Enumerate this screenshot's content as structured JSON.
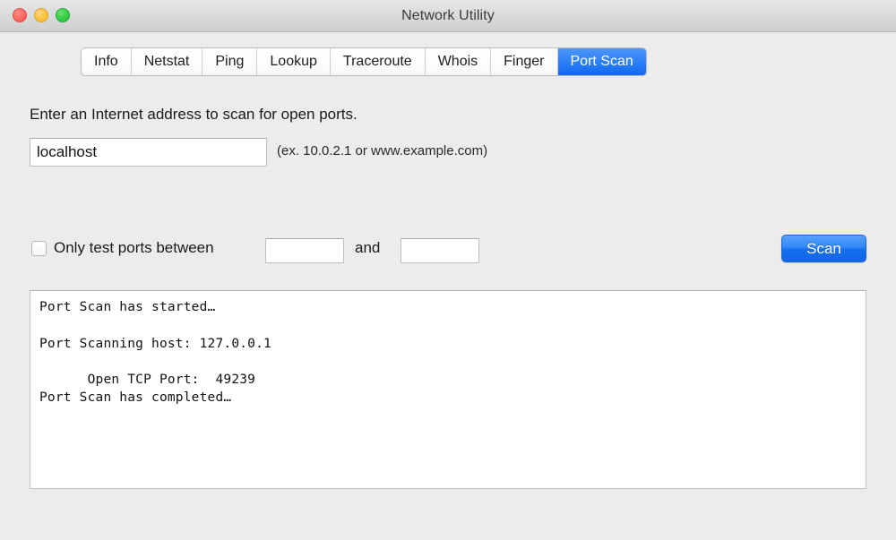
{
  "window": {
    "title": "Network Utility",
    "traffic_lights": [
      {
        "name": "close",
        "color": "#ff5f57"
      },
      {
        "name": "minimize",
        "color": "#ffbd2e"
      },
      {
        "name": "maximize",
        "color": "#28c840"
      }
    ],
    "background_color": "#ececec"
  },
  "tabs": {
    "active": "Port Scan",
    "active_color": "#2d80f7",
    "items": [
      {
        "label": "Info",
        "active": false
      },
      {
        "label": "Netstat",
        "active": false
      },
      {
        "label": "Ping",
        "active": false
      },
      {
        "label": "Lookup",
        "active": false
      },
      {
        "label": "Traceroute",
        "active": false
      },
      {
        "label": "Whois",
        "active": false
      },
      {
        "label": "Finger",
        "active": false
      },
      {
        "label": "Port Scan",
        "active": true
      }
    ]
  },
  "port_scan": {
    "prompt": "Enter an Internet address to scan for open ports.",
    "address": {
      "value": "localhost",
      "placeholder": "",
      "hint": "(ex. 10.0.2.1 or www.example.com)"
    },
    "range": {
      "checkbox_checked": false,
      "label": "Only test ports between",
      "conjunction": "and",
      "from_value": "",
      "from_placeholder": "",
      "to_value": "",
      "to_placeholder": ""
    },
    "scan_button": {
      "label": "Scan",
      "color": "#2f85f8"
    },
    "output": "Port Scan has started…\n\nPort Scanning host: 127.0.0.1\n\n      Open TCP Port:  49239\nPort Scan has completed…"
  }
}
